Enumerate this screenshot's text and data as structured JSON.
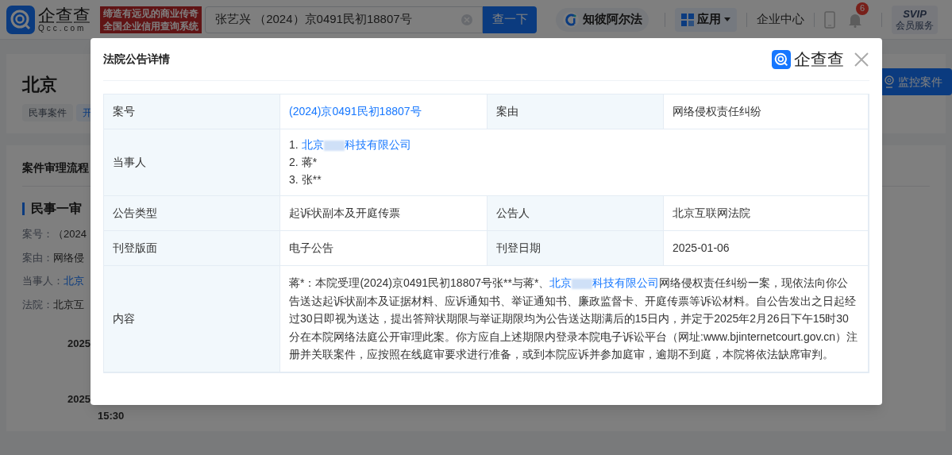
{
  "header": {
    "logo_text": "企查查",
    "logo_domain": "Qcc.com",
    "slogan": [
      "缔造有远见的商业传奇",
      "全国企业信用查询系统"
    ],
    "search": {
      "value": "张艺兴 （2024）京0491民初18807号"
    },
    "search_button": "查一下",
    "ai_button": "知彼阿尔法",
    "apps_button": "应用",
    "enterprise_center": "企业中心",
    "notification_count": "6",
    "vip": {
      "title": "SVIP",
      "subtitle": "会员服务"
    }
  },
  "background": {
    "title_prefix": "北京",
    "tags": [
      "民事案件",
      "开"
    ],
    "monitor_button": "监控案件",
    "section_title": "案件审理流程",
    "stage": "民事一审",
    "fields": [
      {
        "label": "案号：",
        "value": "（2024",
        "kind": "text"
      },
      {
        "label": "案由：",
        "value": "网络侵",
        "kind": "text"
      },
      {
        "label": "当事人：",
        "value": "北京",
        "kind": "link"
      },
      {
        "label": "法院：",
        "value": "北京互",
        "kind": "text"
      }
    ],
    "timeline": [
      {
        "date": "2025"
      },
      {
        "date": "2025",
        "time": "15:30"
      }
    ]
  },
  "modal": {
    "title": "法院公告详情",
    "logo_text": "企查查",
    "rows": [
      {
        "cells": [
          {
            "kind": "label",
            "text": "案号"
          },
          {
            "kind": "link",
            "text": "(2024)京0491民初18807号"
          },
          {
            "kind": "label",
            "text": "案由"
          },
          {
            "kind": "text",
            "text": "网络侵权责任纠纷"
          }
        ]
      },
      {
        "cells": [
          {
            "kind": "label",
            "text": "当事人"
          },
          {
            "kind": "parties",
            "parties": [
              {
                "number": "1.",
                "kind": "company",
                "prefix": "北京",
                "suffix": "科技有限公司"
              },
              {
                "number": "2.",
                "kind": "person",
                "name": "蒋*"
              },
              {
                "number": "3.",
                "kind": "person",
                "name": "张**"
              }
            ]
          }
        ]
      },
      {
        "cells": [
          {
            "kind": "label",
            "text": "公告类型"
          },
          {
            "kind": "text",
            "text": "起诉状副本及开庭传票"
          },
          {
            "kind": "label",
            "text": "公告人"
          },
          {
            "kind": "text",
            "text": "北京互联网法院"
          }
        ]
      },
      {
        "cells": [
          {
            "kind": "label",
            "text": "刊登版面"
          },
          {
            "kind": "text",
            "text": "电子公告"
          },
          {
            "kind": "label",
            "text": "刊登日期"
          },
          {
            "kind": "text",
            "text": "2025-01-06"
          }
        ]
      },
      {
        "cells": [
          {
            "kind": "label",
            "text": "内容"
          },
          {
            "kind": "content",
            "segments": [
              {
                "kind": "text",
                "text": "蒋*：本院受理(2024)京0491民初18807号张**与蒋*、"
              },
              {
                "kind": "company",
                "prefix": "北京",
                "suffix": "科技有限公司"
              },
              {
                "kind": "text",
                "text": "网络侵权责任纠纷一案，现依法向你公告送达起诉状副本及证据材料、应诉通知书、举证通知书、廉政监督卡、开庭传票等诉讼材料。自公告发出之日起经过30日即视为送达，提出答辩状期限与举证期限均为公告送达期满后的15日内，并定于2025年2月26日下午15时30分在本院网络法庭公开审理此案。你方应自上述期限内登录本院电子诉讼平台（网址:www.bjinternetcourt.gov.cn）注册并关联案件，应按照在线庭审要求进行准备，或到本院应诉并参加庭审，逾期不到庭，本院将依法缺席审判。"
              }
            ]
          }
        ]
      }
    ]
  }
}
